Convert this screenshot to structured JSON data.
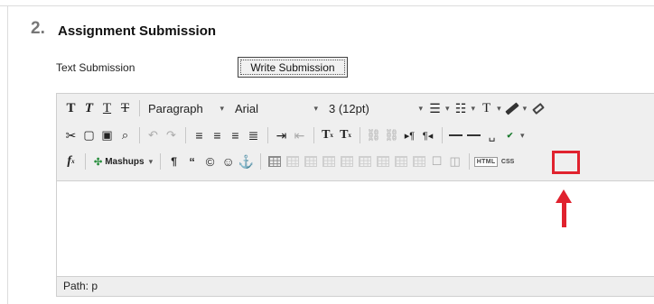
{
  "section": {
    "number": "2.",
    "title": "Assignment Submission"
  },
  "text_submission": {
    "label": "Text Submission",
    "button_label": "Write Submission"
  },
  "toolbar": {
    "format_dropdown": "Paragraph",
    "font_dropdown": "Arial",
    "size_dropdown": "3 (12pt)",
    "mashups_label": "Mashups",
    "html_label": "HTML",
    "css_label": "CSS"
  },
  "path": "Path: p",
  "colors": {
    "highlight": "#e0222e",
    "toolbar_bg": "#efefef"
  },
  "icons": [
    "bold-icon",
    "italic-icon",
    "underline-icon",
    "strikethrough-icon",
    "bullet-list-icon",
    "numbered-list-icon",
    "text-color-icon",
    "highlight-pen-icon",
    "eraser-icon",
    "cut-icon",
    "copy-icon",
    "paste-icon",
    "find-icon",
    "undo-icon",
    "redo-icon",
    "align-left-icon",
    "align-center-icon",
    "align-right-icon",
    "justify-icon",
    "indent-icon",
    "outdent-icon",
    "superscript-icon",
    "subscript-icon",
    "link-icon",
    "unlink-icon",
    "ltr-icon",
    "rtl-icon",
    "horizontal-rule-icon",
    "nonbreaking-space-icon",
    "spellcheck-icon",
    "formula-icon",
    "paragraph-mark-icon",
    "blockquote-icon",
    "copyright-icon",
    "emoticon-icon",
    "anchor-icon",
    "table-icon",
    "html-icon",
    "css-icon",
    "red-arrow-icon"
  ]
}
